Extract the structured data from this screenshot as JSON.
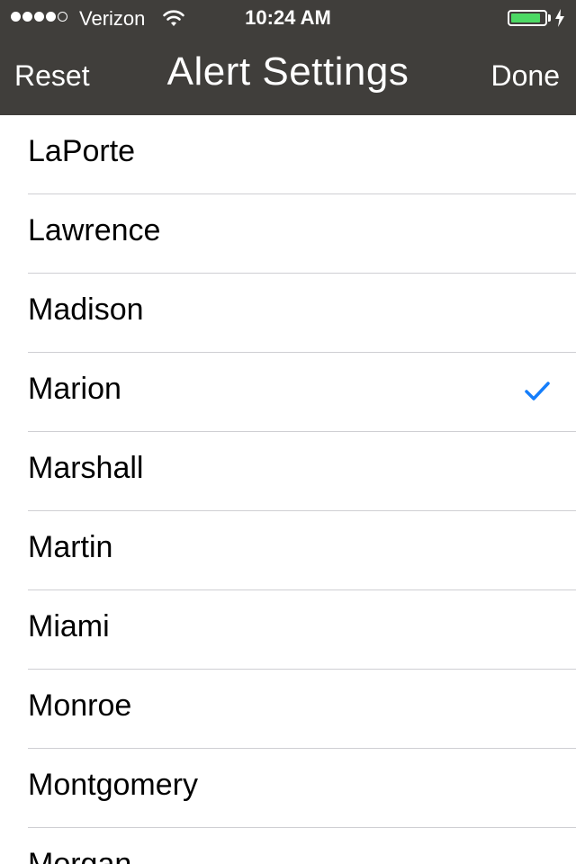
{
  "status_bar": {
    "carrier": "Verizon",
    "time": "10:24 AM",
    "signal_bars_filled": 4,
    "signal_bars_total": 5,
    "battery_level": 0.9,
    "battery_color": "#4cd964",
    "icons": [
      "wifi-icon",
      "battery-icon",
      "charging-bolt-icon"
    ]
  },
  "nav": {
    "left_label": "Reset",
    "title": "Alert Settings",
    "right_label": "Done",
    "background": "#403e3b"
  },
  "list": {
    "accent": "#157efb",
    "items": [
      {
        "label": "LaPorte",
        "checked": false
      },
      {
        "label": "Lawrence",
        "checked": false
      },
      {
        "label": "Madison",
        "checked": false
      },
      {
        "label": "Marion",
        "checked": true
      },
      {
        "label": "Marshall",
        "checked": false
      },
      {
        "label": "Martin",
        "checked": false
      },
      {
        "label": "Miami",
        "checked": false
      },
      {
        "label": "Monroe",
        "checked": false
      },
      {
        "label": "Montgomery",
        "checked": false
      },
      {
        "label": "Morgan",
        "checked": false
      }
    ]
  }
}
